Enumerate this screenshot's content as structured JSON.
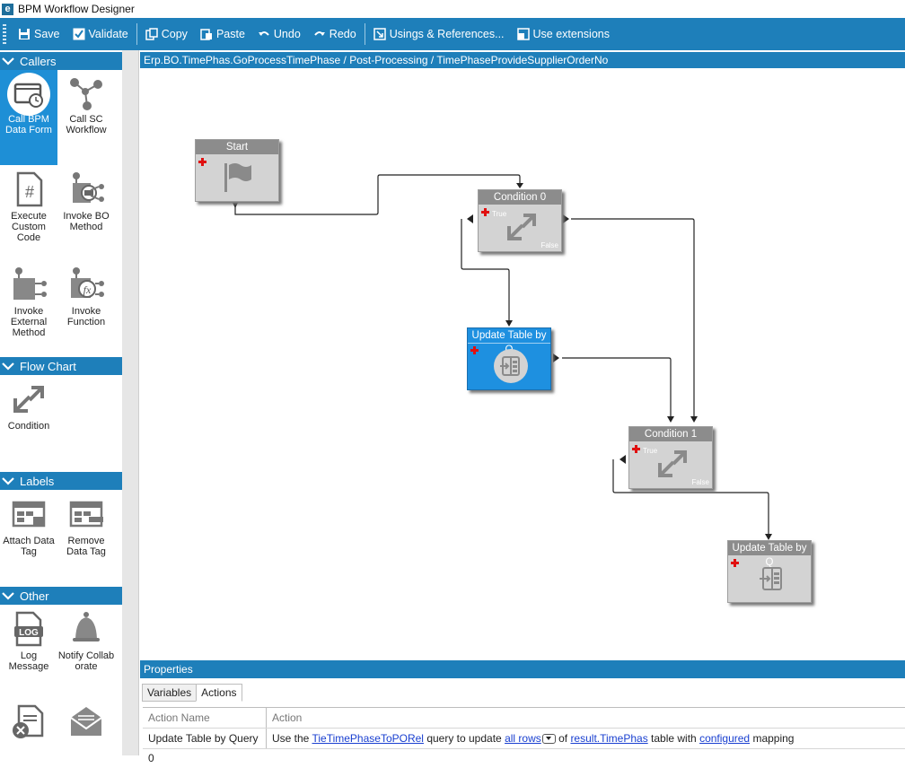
{
  "window": {
    "title": "BPM Workflow Designer",
    "logo_letter": "e"
  },
  "toolbar": {
    "save": "Save",
    "validate": "Validate",
    "copy": "Copy",
    "paste": "Paste",
    "undo": "Undo",
    "redo": "Redo",
    "usings": "Usings & References...",
    "extensions": "Use extensions"
  },
  "sidebar": {
    "sections": {
      "callers": "Callers",
      "flow_chart": "Flow Chart",
      "labels": "Labels",
      "other": "Other"
    },
    "callers": [
      "Call BPM Data Form",
      "Call SC Workflow",
      "Execute Custom Code",
      "Invoke BO Method",
      "Invoke External Method",
      "Invoke Function"
    ],
    "flow_chart": [
      "Condition"
    ],
    "labels": [
      "Attach Data Tag",
      "Remove Data Tag"
    ],
    "other": [
      "Log Message",
      "Notify Collaborate"
    ]
  },
  "breadcrumb": "Erp.BO.TimePhas.GoProcessTimePhase / Post-Processing / TimePhaseProvideSupplierOrderNo",
  "nodes": {
    "start": "Start",
    "condition0": "Condition 0",
    "update0": "Update Table by Q",
    "condition1": "Condition 1",
    "update1": "Update Table by Q",
    "true_label": "True",
    "false_label": "False",
    "log_text": "LOG"
  },
  "properties": {
    "title": "Properties",
    "tabs": [
      "Variables",
      "Actions"
    ],
    "active_tab": "Actions",
    "columns": [
      "Action Name",
      "Action"
    ],
    "row": {
      "name": "Update Table by Query 0",
      "t1": "Use the ",
      "query": "TieTimePhaseToPORel",
      "t2": " query to update ",
      "rows": "all rows",
      "t3": " of ",
      "table": "result.TimePhas",
      "t4": " table with ",
      "mapping": "configured",
      "t5": " mapping"
    }
  }
}
